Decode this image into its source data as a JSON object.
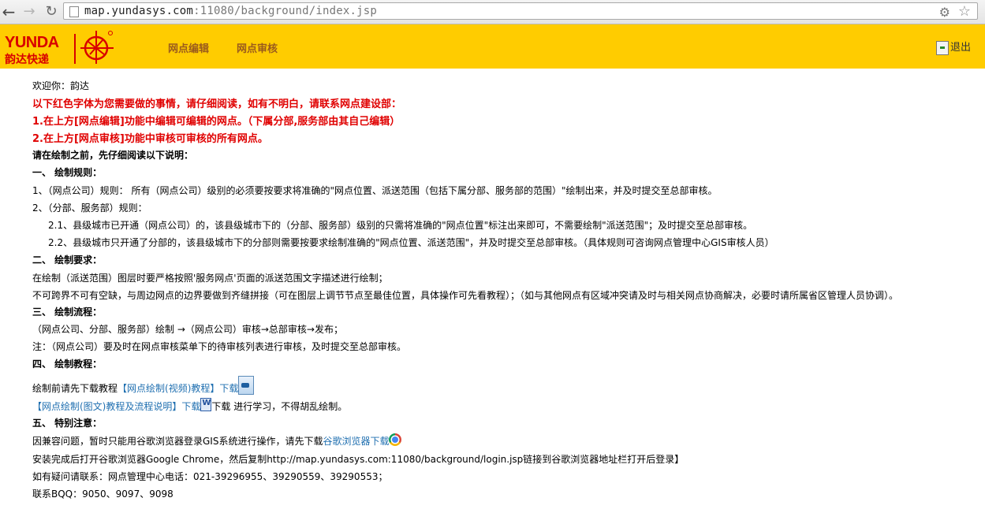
{
  "browser": {
    "url_host": "map.yundasys.com",
    "url_path": ":11080/background/index.jsp"
  },
  "header": {
    "logo_en": "YUNDA",
    "logo_cn": "韵达快递",
    "nav_edit": "网点编辑",
    "nav_review": "网点审核",
    "logout": "退出"
  },
  "content": {
    "welcome": "欢迎你：韵达",
    "red1": "以下红色字体为您需要做的事情，请仔细阅读，如有不明白，请联系网点建设部：",
    "red2": "1.在上方[网点编辑]功能中编辑可编辑的网点。（下属分部,服务部由其自己编辑）",
    "red3": "2.在上方[网点审核]功能中审核可审核的所有网点。",
    "intro": "请在绘制之前，先仔细阅读以下说明：",
    "sec1_title": "一、 绘制规则：",
    "rule1": "1、（网点公司）规则： 所有（网点公司）级别的必须要按要求将准确的\"网点位置、派送范围（包括下属分部、服务部的范围）\"绘制出来，并及时提交至总部审核。",
    "rule2": "2、（分部、服务部）规则：",
    "rule21": "2.1、县级城市已开通（网点公司）的，该县级城市下的（分部、服务部）级别的只需将准确的\"网点位置\"标注出来即可，不需要绘制\"派送范围\"；及时提交至总部审核。",
    "rule22": "2.2、县级城市只开通了分部的，该县级城市下的分部则需要按要求绘制准确的\"网点位置、派送范围\"，并及时提交至总部审核。（具体规则可咨询网点管理中心GIS审核人员）",
    "sec2_title": "二、 绘制要求：",
    "req1": "在绘制（派送范围）图层时要严格按照'服务网点'页面的派送范围文字描述进行绘制；",
    "req2": "不可跨界不可有空缺，与周边网点的边界要做到齐缝拼接（可在图层上调节节点至最佳位置，具体操作可先看教程）；（如与其他网点有区域冲突请及时与相关网点协商解决，必要时请所属省区管理人员协调）。",
    "sec3_title": "三、 绘制流程：",
    "flow1": "（网点公司、分部、服务部）绘制 →（网点公司）审核→总部审核→发布；",
    "flow2": "注：（网点公司）要及时在网点审核菜单下的待审核列表进行审核，及时提交至总部审核。",
    "sec4_title": "四、 绘制教程：",
    "tut_prefix": "绘制前请先下载教程",
    "tut_video_link": "【网点绘制(视频)教程】下载",
    "tut_doc_link": "【网点绘制(图文)教程及流程说明】下载",
    "tut_suffix": "下载 进行学习，不得胡乱绘制。",
    "sec5_title": "五、 特别注意：",
    "note1_prefix": "因兼容问题，暂时只能用谷歌浏览器登录GIS系统进行操作，请先下载",
    "note1_link": "谷歌浏览器下载",
    "note2": "安装完成后打开谷歌浏览器Google Chrome，然后复制http://map.yundasys.com:11080/background/login.jsp链接到谷歌浏览器地址栏打开后登录】",
    "contact": "如有疑问请联系：网点管理中心电话：021-39296955、39290559、39290553；",
    "bqq": "联系BQQ：9050、9097、9098"
  }
}
